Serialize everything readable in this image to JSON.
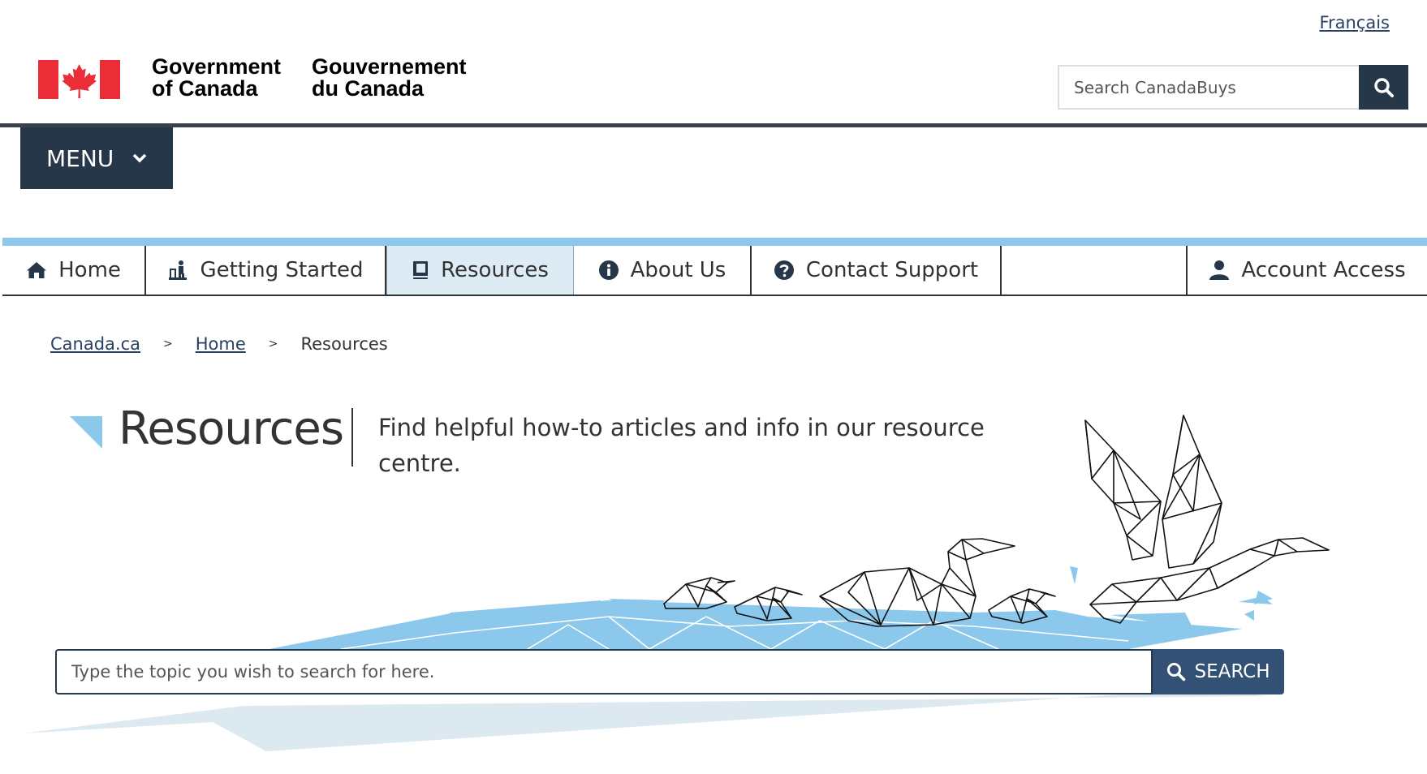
{
  "header": {
    "language_link": "Français",
    "gov_name_en_line1": "Government",
    "gov_name_en_line2": "of Canada",
    "gov_name_fr_line1": "Gouvernement",
    "gov_name_fr_line2": "du Canada",
    "site_search_placeholder": "Search CanadaBuys",
    "menu_label": "MENU"
  },
  "nav": {
    "items": [
      {
        "label": "Home",
        "icon": "home-icon"
      },
      {
        "label": "Getting Started",
        "icon": "getting-started-icon"
      },
      {
        "label": "Resources",
        "icon": "book-icon",
        "active": true
      },
      {
        "label": "About Us",
        "icon": "info-icon"
      },
      {
        "label": "Contact Support",
        "icon": "question-icon"
      },
      {
        "label": "Account Access",
        "icon": "user-icon"
      }
    ]
  },
  "breadcrumb": {
    "items": [
      "Canada.ca",
      "Home"
    ],
    "current": "Resources"
  },
  "page": {
    "title": "Resources",
    "intro": "Find helpful how-to articles and info in our resource centre."
  },
  "topic_search": {
    "placeholder": "Type the topic you wish to search for here.",
    "button_label": "SEARCH"
  },
  "colors": {
    "brand_dark": "#26374a",
    "accent_light_blue": "#8cc8ec",
    "active_tab_bg": "#dcebf4",
    "flag_red": "#eb2d37",
    "search_button": "#335075"
  }
}
